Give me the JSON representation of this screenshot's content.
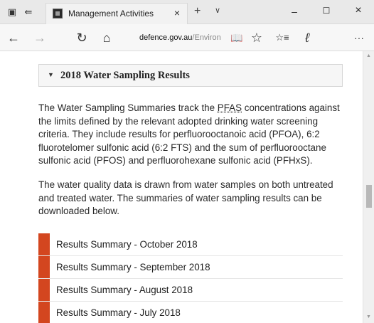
{
  "titlebar": {
    "tab_title": "Management Activities",
    "tab_close": "×",
    "new_tab": "+",
    "tab_list": "∨",
    "minimize": "–",
    "maximize": "☐",
    "close": "×"
  },
  "navbar": {
    "url_host": "defence.gov.au",
    "url_path": "/Environ",
    "back": "←",
    "forward": "→",
    "refresh": "↻",
    "home": "⌂",
    "reading_view": "📖",
    "favorite": "☆",
    "favorites_hub": "☆≡",
    "notes": "ℓ",
    "more": "···"
  },
  "section": {
    "caret": "▼",
    "title": "2018 Water Sampling Results",
    "para1_pre": "The Water Sampling Summaries track the ",
    "para1_abbr": "PFAS",
    "para1_post": " concentrations against the limits defined by the relevant adopted drinking water screening criteria. They include results for perfluorooctanoic acid (PFOA), 6:2 fluorotelomer sulfonic acid (6:2 FTS) and the sum of perfluorooctane sulfonic acid (PFOS) and perfluorohexane sulfonic acid (PFHxS).",
    "para2": "The water quality data is drawn from water samples on both untreated and treated water. The summaries of water sampling results can be downloaded below."
  },
  "results": [
    "Results Summary - October 2018",
    "Results Summary - September 2018",
    "Results Summary - August 2018",
    "Results Summary - July 2018"
  ],
  "colors": {
    "accent": "#d3461f"
  }
}
